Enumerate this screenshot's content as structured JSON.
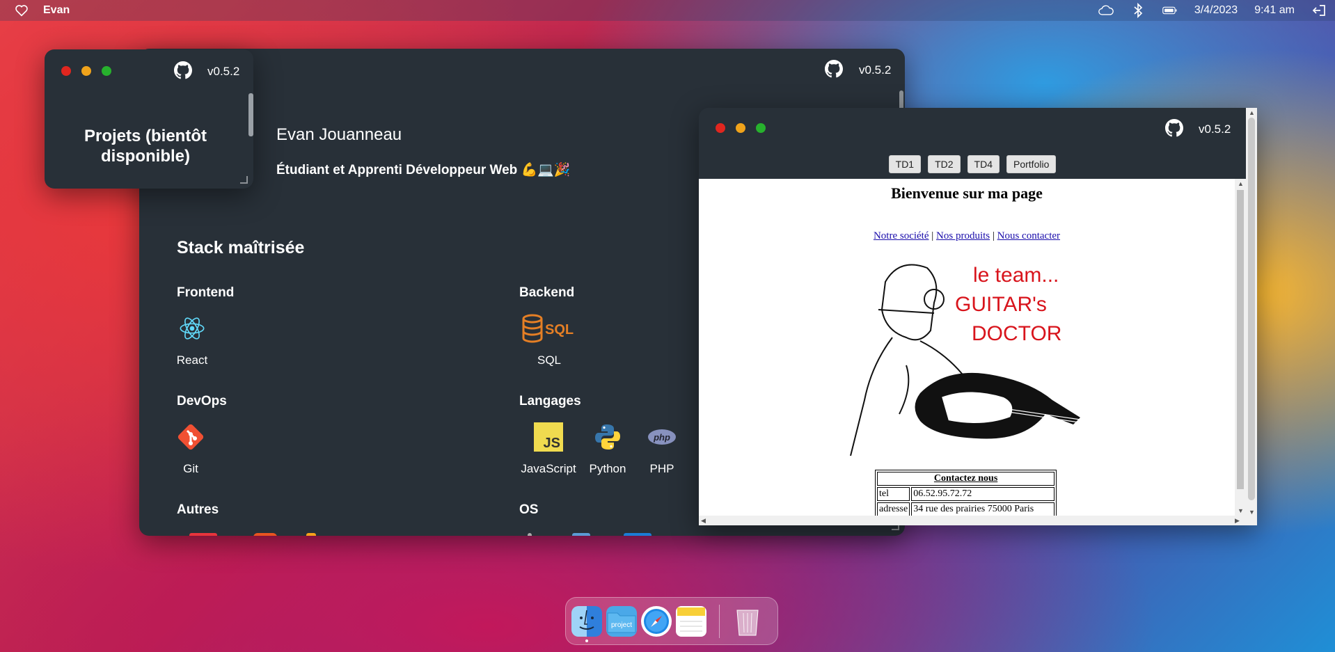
{
  "menubar": {
    "app_name": "Evan",
    "date": "3/4/2023",
    "time": "9:41 am",
    "icons": [
      "heart-icon",
      "cloud-icon",
      "bluetooth-icon",
      "battery-icon",
      "logout-icon"
    ]
  },
  "main_window": {
    "version": "v0.5.2",
    "profile": {
      "name": "Evan Jouanneau",
      "subtitle": "Étudiant et Apprenti Développeur Web 💪💻🎉"
    },
    "stack_title": "Stack maîtrisée",
    "categories": {
      "frontend": "Frontend",
      "backend": "Backend",
      "devops": "DevOps",
      "langages": "Langages",
      "autres": "Autres",
      "os": "OS"
    },
    "techs": {
      "react": "React",
      "sql": "SQL",
      "git": "Git",
      "javascript": "JavaScript",
      "python": "Python",
      "php": "PHP"
    },
    "logo_texts": {
      "sql": "SQL",
      "js": "JS",
      "php": "php"
    }
  },
  "projects_window": {
    "version": "v0.5.2",
    "title": "Projets (bientôt disponible)"
  },
  "web_window": {
    "version": "v0.5.2",
    "tabs": [
      "TD1",
      "TD2",
      "TD4",
      "Portfolio"
    ],
    "page": {
      "heading": "Bienvenue sur ma page",
      "nav": [
        "Notre société",
        "Nos produits",
        "Nous contacter"
      ],
      "nav_separator": "|",
      "hero_text": [
        "le team...",
        "GUITAR's",
        "DOCTOR"
      ],
      "contact": {
        "header": "Contactez nous",
        "rows": [
          [
            "tel",
            "06.52.95.72.72"
          ],
          [
            "adresse",
            "34 rue des prairies 75000 Paris"
          ]
        ]
      }
    }
  },
  "dock": {
    "items": [
      "finder-icon",
      "project-folder-icon",
      "safari-icon",
      "notes-icon",
      "trash-icon"
    ],
    "folder_label": "project"
  },
  "colors": {
    "window_bg": "#283038",
    "react": "#61dafb",
    "sql": "#e57f25",
    "git": "#f05033",
    "js": "#f0db4f",
    "python_blue": "#3776ab",
    "python_yellow": "#ffd43b",
    "php": "#8892bf"
  }
}
